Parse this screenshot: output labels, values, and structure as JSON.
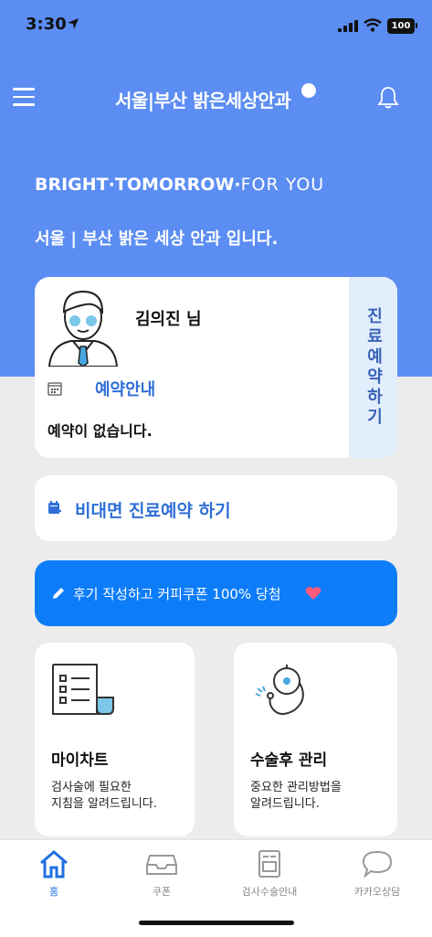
{
  "status_bar": {
    "time": "3:30",
    "battery": "100"
  },
  "header": {
    "logo_text": "서울|부산 밝은세상안과"
  },
  "hero": {
    "tagline_bold": "BRIGHT·TOMORROW·",
    "tagline_light": "FOR YOU",
    "subtitle": "서울 | 부산 밝은 세상 안과 입니다."
  },
  "profile": {
    "name": "김의진 님",
    "reservation_title": "예약안내",
    "reservation_status": "예약이 없습니다.",
    "book_button": "진료예약하기"
  },
  "telemed": {
    "label": "비대면 진료예약 하기"
  },
  "promo": {
    "text": "후기 작성하고 커피쿠폰 100% 당첨"
  },
  "tiles": [
    {
      "title": "마이차트",
      "desc": "검사술에 필요한\n지침을 알려드립니다."
    },
    {
      "title": "수술후 관리",
      "desc": "중요한 관리방법을\n알려드립니다."
    }
  ],
  "tabs": [
    {
      "label": "홈"
    },
    {
      "label": "쿠폰"
    },
    {
      "label": "검사수술안내"
    },
    {
      "label": "카카오상담"
    }
  ],
  "colors": {
    "hero": "#5b8df2",
    "accent": "#2f6fd6",
    "promo": "#0d7cf9",
    "side": "#e3eefc"
  }
}
